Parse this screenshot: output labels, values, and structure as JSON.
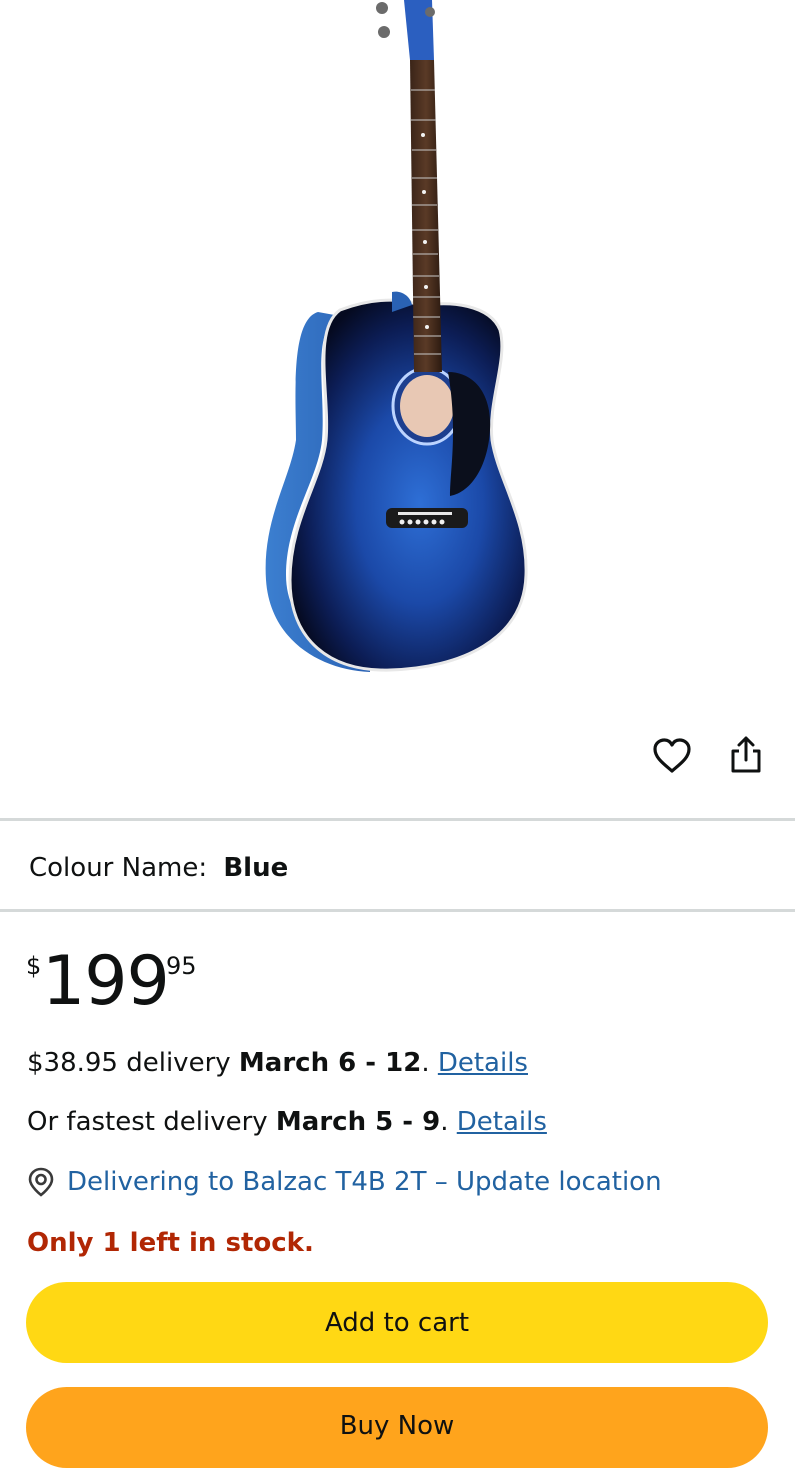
{
  "product": {
    "image_alt": "Blue acoustic guitar",
    "colour_label": "Colour Name:",
    "colour_value": "Blue"
  },
  "price": {
    "symbol": "$",
    "whole": "199",
    "fraction": "95"
  },
  "delivery": {
    "standard_prefix": "$38.95 delivery",
    "standard_dates": "March 6 - 12",
    "standard_details": "Details",
    "fastest_prefix": "Or fastest delivery",
    "fastest_dates": "March 5 - 9",
    "fastest_details": "Details",
    "location_text": "Delivering to Balzac T4B 2T – Update location"
  },
  "stock": {
    "text": "Only 1 left in stock."
  },
  "actions": {
    "add_to_cart": "Add to cart",
    "buy_now": "Buy Now"
  },
  "icons": {
    "wishlist": "heart-icon",
    "share": "share-icon",
    "location": "location-pin-icon"
  },
  "colors": {
    "add_to_cart_bg": "#ffd814",
    "buy_now_bg": "#ffa41c",
    "link": "#2162a1",
    "stock_red": "#b12704",
    "divider": "#d5d9d9"
  }
}
